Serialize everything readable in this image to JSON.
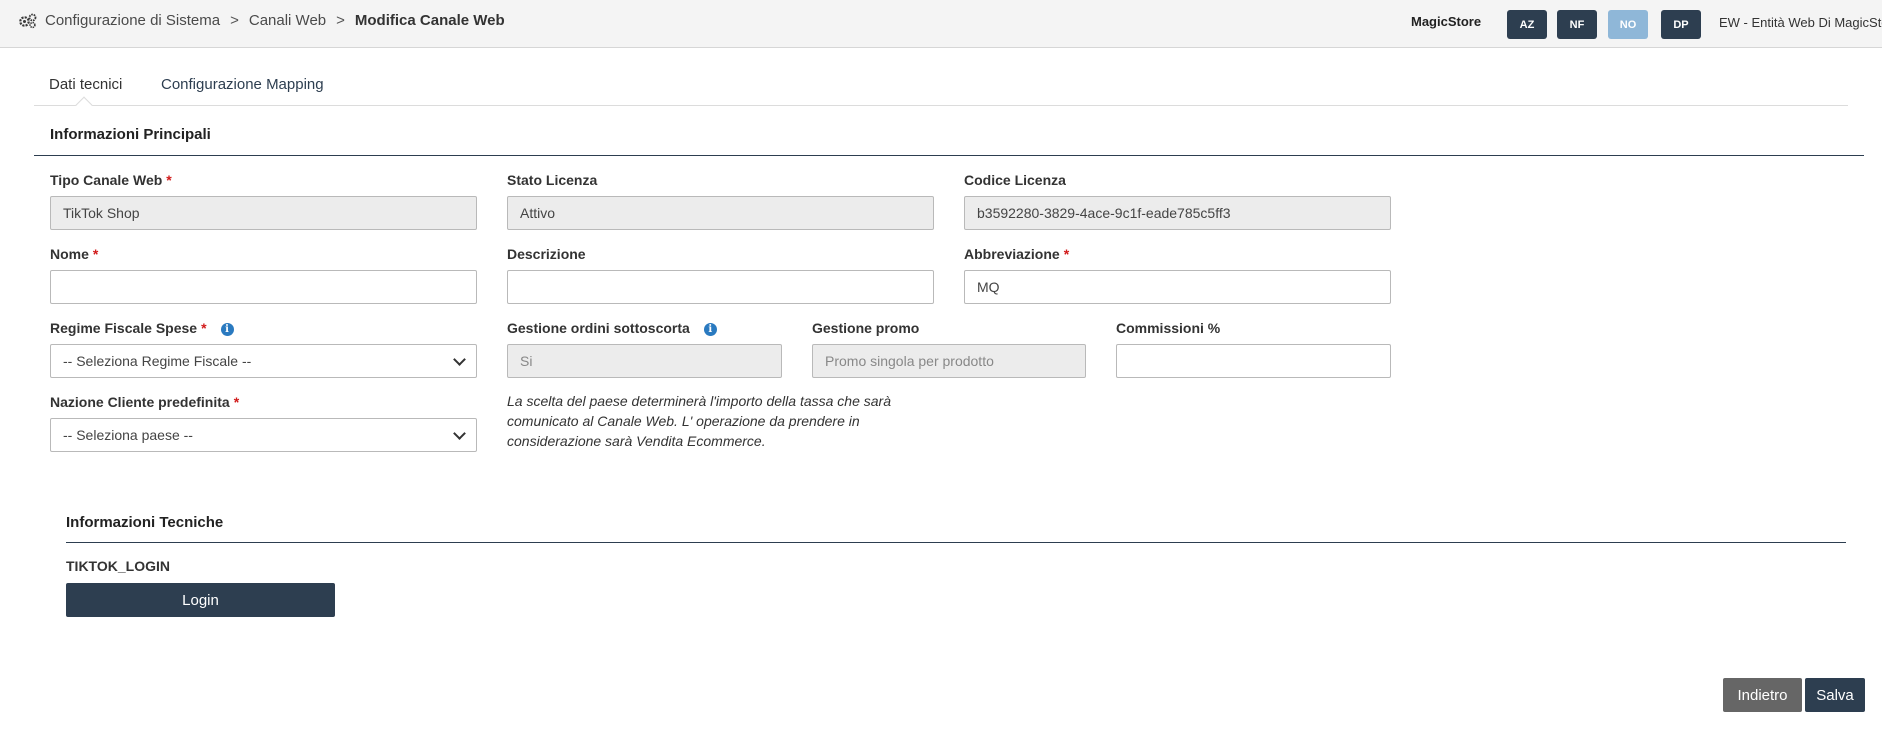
{
  "breadcrumb": {
    "items": [
      "Configurazione di Sistema",
      "Canali Web"
    ],
    "separator": ">",
    "current": "Modifica Canale Web"
  },
  "header": {
    "store": "MagicStore",
    "chips": [
      "AZ",
      "NF",
      "NO",
      "DP"
    ],
    "entity": "EW - Entità Web Di MagicStore"
  },
  "tabs": [
    "Dati tecnici",
    "Configurazione Mapping"
  ],
  "main": {
    "title": "Informazioni Principali",
    "fields": {
      "tipo_canale": {
        "label": "Tipo Canale Web",
        "value": "TikTok Shop"
      },
      "stato_licenza": {
        "label": "Stato Licenza",
        "value": "Attivo"
      },
      "codice_licenza": {
        "label": "Codice Licenza",
        "value": "b3592280-3829-4ace-9c1f-eade785c5ff3"
      },
      "nome": {
        "label": "Nome",
        "value": ""
      },
      "descrizione": {
        "label": "Descrizione",
        "value": ""
      },
      "abbreviazione": {
        "label": "Abbreviazione",
        "value": "MQ"
      },
      "regime_fiscale": {
        "label": "Regime Fiscale Spese",
        "value": "-- Seleziona Regime Fiscale --"
      },
      "gestione_sottoscorta": {
        "label": "Gestione ordini sottoscorta",
        "value": "Si"
      },
      "gestione_promo": {
        "label": "Gestione promo",
        "value": "Promo singola per prodotto"
      },
      "commissioni": {
        "label": "Commissioni %",
        "value": ""
      },
      "nazione": {
        "label": "Nazione Cliente predefinita",
        "value": "-- Seleziona paese --"
      }
    },
    "required_mark": "*",
    "info_icon": "i",
    "note": "La scelta del paese determinerà l'importo della tassa che sarà comunicato al Canale Web. L' operazione da prendere in considerazione sarà Vendita Ecommerce."
  },
  "tech": {
    "title": "Informazioni Tecniche",
    "login_label": "TIKTOK_LOGIN",
    "login_button": "Login"
  },
  "footer": {
    "back": "Indietro",
    "save": "Salva"
  },
  "colors": {
    "primary": "#2d3e50",
    "chip_light": "#8fb7d8",
    "required": "#d11a1a",
    "info": "#2a7ac0",
    "back_button": "#666666"
  }
}
